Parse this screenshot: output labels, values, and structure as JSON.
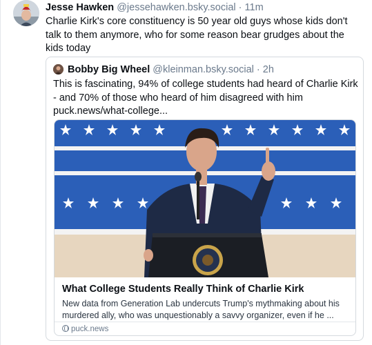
{
  "post": {
    "author_name": "Jesse Hawken",
    "author_handle": "@jessehawken.bsky.social",
    "separator": "·",
    "time": "11m",
    "text": "Charlie Kirk's core constituency is 50 year old guys whose kids don't talk to them anymore, who for some reason bear grudges about the kids today"
  },
  "quote": {
    "author_name": "Bobby Big Wheel",
    "author_handle": "@kleinman.bsky.social",
    "separator": "·",
    "time": "2h",
    "text": "This is fascinating, 94% of college students had heard of Charlie Kirk - and 70% of those who heard of him disagreed with him puck.news/what-college..."
  },
  "link_card": {
    "title": "What College Students Really Think of Charlie Kirk",
    "description": "New data from Generation Lab undercuts Trump's mythmaking about his murdered ally, who was unquestionably a savvy organizer, even if he ...",
    "source": "puck.news",
    "image_icon": "podium-speaker-photo"
  },
  "icons": {
    "avatar": "user-avatar-icon",
    "source_globe": "globe-icon"
  },
  "colors": {
    "text": "#0b0f14",
    "muted": "#6b7a8c",
    "border": "#d4d9de",
    "backdrop_blue": "#2b5fb8"
  }
}
